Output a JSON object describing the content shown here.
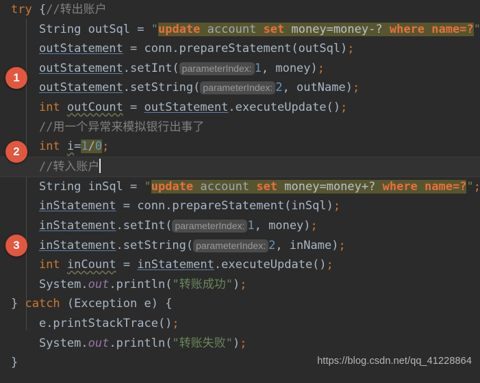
{
  "editor": {
    "background": "#2b2b2b",
    "current_line_background": "#323232",
    "badge_color": "#e2573f",
    "sql_highlight_background": "#57552f"
  },
  "watermark": {
    "text": "https://blog.csdn.net/qq_41228864"
  },
  "badges": [
    {
      "label": "1",
      "line": 3
    },
    {
      "label": "2",
      "line": 7
    },
    {
      "label": "3",
      "line": 11
    }
  ],
  "code": {
    "line1": {
      "kw_try": "try",
      "brace": " {",
      "comment": "//转出账户"
    },
    "line2": {
      "type": "String",
      "var": " outSql = ",
      "quote_open": "\"",
      "sql_update": "update",
      "sql_sp1": " ",
      "sql_account": "account",
      "sql_sp2": " ",
      "sql_set": "set",
      "sql_sp3": " ",
      "sql_expr": "money=money-?",
      "sql_sp4": " ",
      "sql_where": "where",
      "sql_sp5": " ",
      "sql_name": "name=?",
      "quote_close": "\"",
      "semi": ";"
    },
    "line3": {
      "field": "outStatement",
      "rest": " = conn.prepareStatement(outSql)",
      "semi": ";"
    },
    "line4": {
      "field": "outStatement",
      "call": ".setInt(",
      "hint": "parameterIndex:",
      "num": "1",
      "args": ", money)",
      "semi": ";"
    },
    "line5": {
      "field": "outStatement",
      "call": ".setString(",
      "hint": "parameterIndex:",
      "num": "2",
      "args": ", outName)",
      "semi": ";"
    },
    "line6": {
      "kw_int": "int",
      "var": "outCount",
      "eq": " = ",
      "field": "outStatement",
      "call": ".executeUpdate()",
      "semi": ";"
    },
    "line7": {
      "comment": "//用一个异常来模拟银行出事了"
    },
    "line8": {
      "kw_int": "int",
      "var": "i",
      "eq": "=",
      "num1": "1",
      "slash": "/",
      "num2": "0",
      "semi": ";"
    },
    "line9": {
      "comment": "//转入账户"
    },
    "line10": {
      "type": "String",
      "var": " inSql = ",
      "quote_open": "\"",
      "sql_update": "update",
      "sql_sp1": " ",
      "sql_account": "account",
      "sql_sp2": " ",
      "sql_set": "set",
      "sql_sp3": " ",
      "sql_expr": "money=money+?",
      "sql_sp4": " ",
      "sql_where": "where",
      "sql_sp5": " ",
      "sql_name": "name=?",
      "quote_close": "\"",
      "semi": ";"
    },
    "line11": {
      "field": "inStatement",
      "rest": " = conn.prepareStatement(inSql)",
      "semi": ";"
    },
    "line12": {
      "field": "inStatement",
      "call": ".setInt(",
      "hint": "parameterIndex:",
      "num": "1",
      "args": ", money)",
      "semi": ";"
    },
    "line13": {
      "field": "inStatement",
      "call": ".setString(",
      "hint": "parameterIndex:",
      "num": "2",
      "args": ", inName)",
      "semi": ";"
    },
    "line14": {
      "kw_int": "int",
      "var": "inCount",
      "eq": " = ",
      "field": "inStatement",
      "call": ".executeUpdate()",
      "semi": ";"
    },
    "line15": {
      "sys": "System.",
      "out": "out",
      "call": ".println(",
      "str": "\"转账成功\"",
      "close": ")",
      "semi": ";"
    },
    "line16": {
      "brace_close": "} ",
      "kw_catch": "catch",
      "rest": " (Exception e) {"
    },
    "line17": {
      "call": "e.printStackTrace()",
      "semi": ";"
    },
    "line18": {
      "sys": "System.",
      "out": "out",
      "call": ".println(",
      "str": "\"转账失败\"",
      "close": ")",
      "semi": ";"
    },
    "line19": {
      "brace_close": "}"
    }
  }
}
